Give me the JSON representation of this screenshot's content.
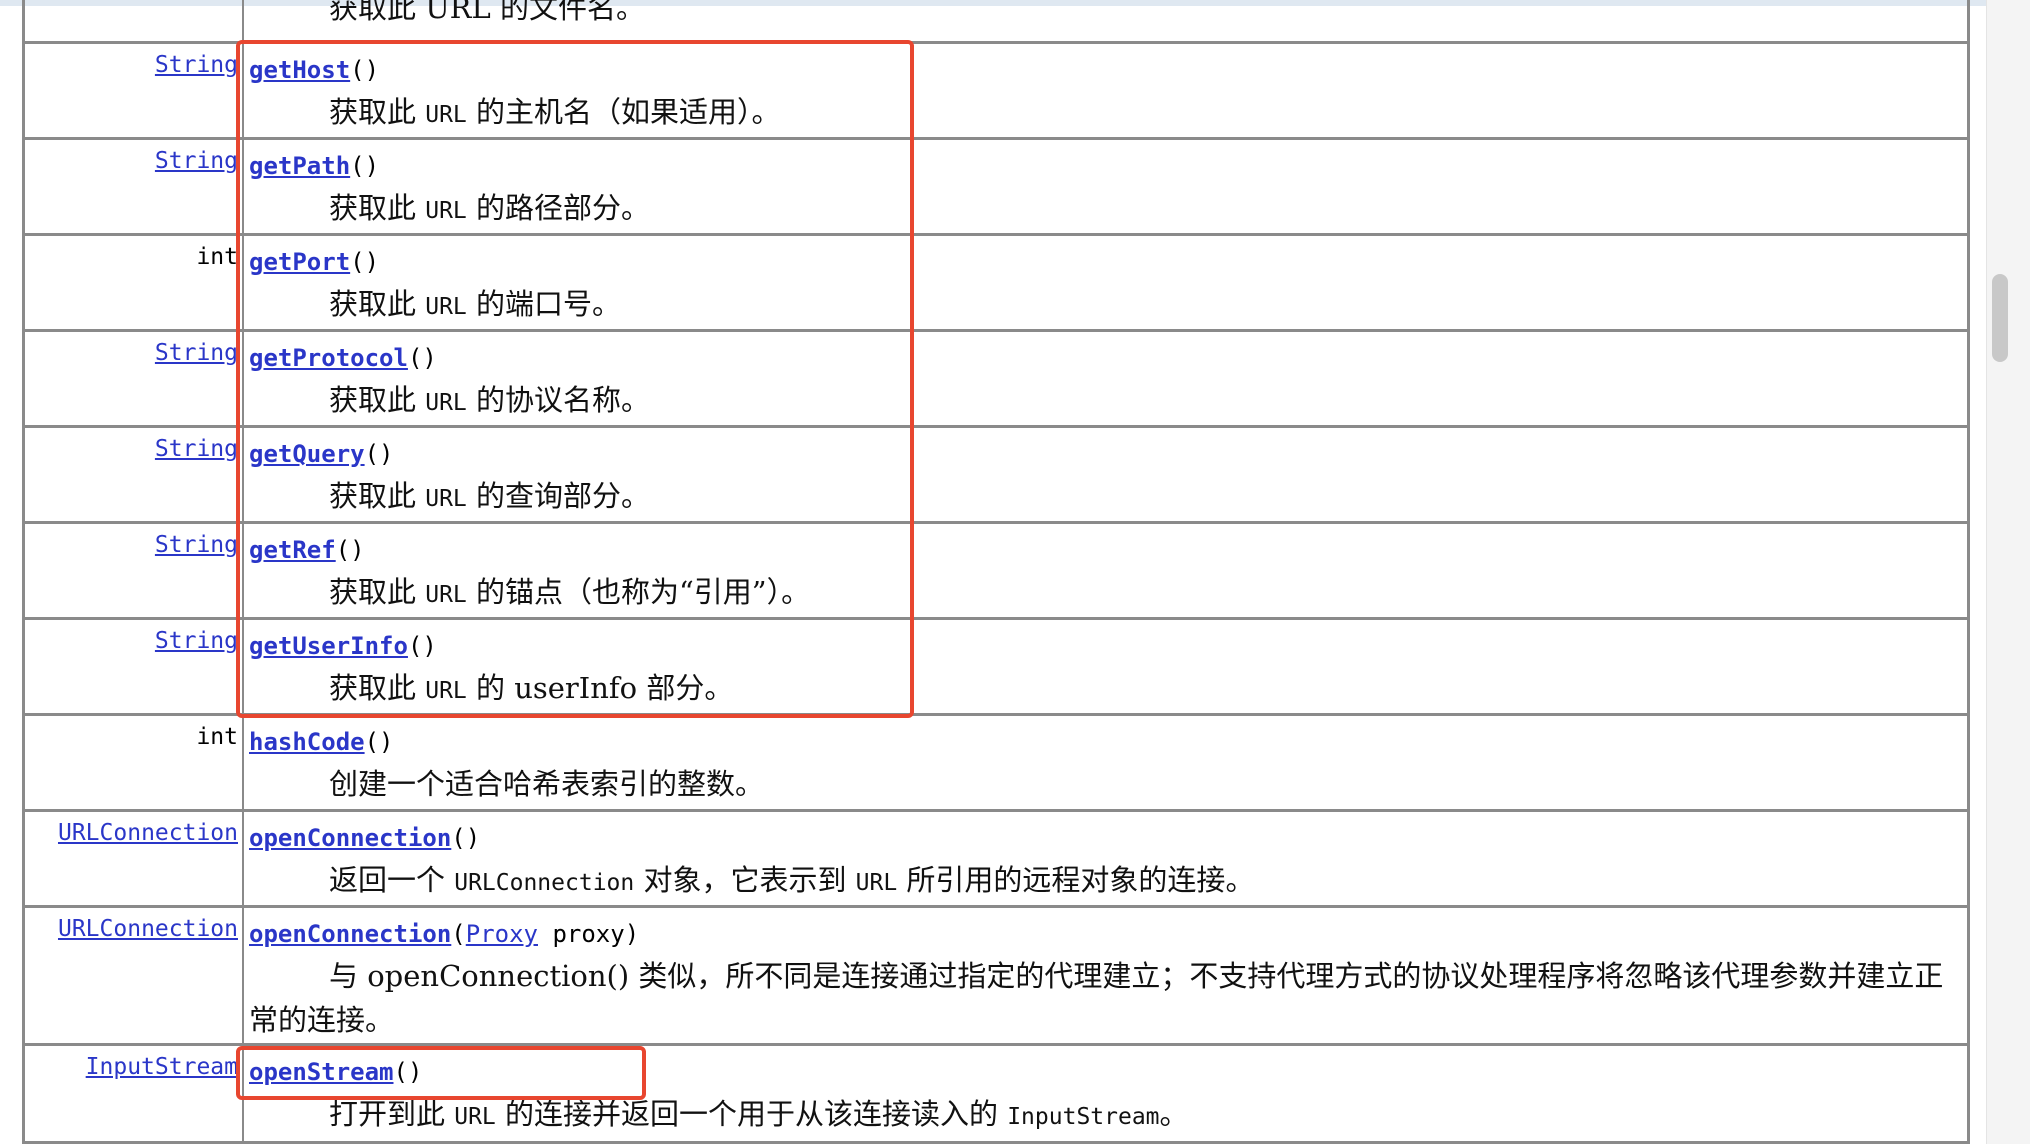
{
  "top_fragment": "获取此 URL 的文件名。",
  "rows": [
    {
      "type": "String",
      "type_link": true,
      "method": "getHost",
      "args": [],
      "desc": [
        "获取此 ",
        "URL",
        " 的主机名（如果适用）。"
      ]
    },
    {
      "type": "String",
      "type_link": true,
      "method": "getPath",
      "args": [],
      "desc": [
        "获取此 ",
        "URL",
        " 的路径部分。"
      ]
    },
    {
      "type": "int",
      "type_link": false,
      "method": "getPort",
      "args": [],
      "desc": [
        "获取此 ",
        "URL",
        " 的端口号。"
      ]
    },
    {
      "type": "String",
      "type_link": true,
      "method": "getProtocol",
      "args": [],
      "desc": [
        "获取此 ",
        "URL",
        " 的协议名称。"
      ]
    },
    {
      "type": "String",
      "type_link": true,
      "method": "getQuery",
      "args": [],
      "desc": [
        "获取此 ",
        "URL",
        " 的查询部分。"
      ]
    },
    {
      "type": "String",
      "type_link": true,
      "method": "getRef",
      "args": [],
      "desc": [
        "获取此 ",
        "URL",
        " 的锚点（也称为“引用”）。"
      ]
    },
    {
      "type": "String",
      "type_link": true,
      "method": "getUserInfo",
      "args": [],
      "desc": [
        "获取此 ",
        "URL",
        " 的 userInfo 部分。"
      ]
    },
    {
      "type": "int",
      "type_link": false,
      "method": "hashCode",
      "args": [],
      "desc": [
        "创建一个适合哈希表索引的整数。"
      ]
    },
    {
      "type": "URLConnection",
      "type_link": true,
      "method": "openConnection",
      "args": [],
      "desc": [
        "返回一个 ",
        "URLConnection",
        " 对象，它表示到 ",
        "URL",
        " 所引用的远程对象的连接。"
      ]
    },
    {
      "type": "URLConnection",
      "type_link": true,
      "method": "openConnection",
      "args": [
        "Proxy",
        " proxy"
      ],
      "desc": [
        "与 openConnection() 类似，所不同是连接通过指定的代理建立；不支持代理方式的协议处理程序将忽略该代理参数并建立正常的连接。"
      ]
    },
    {
      "type": "InputStream",
      "type_link": true,
      "method": "openStream",
      "args": [],
      "desc": [
        "打开到此 ",
        "URL",
        " 的连接并返回一个用于从该连接读入的 ",
        "InputStream",
        "。"
      ]
    }
  ],
  "paren_open": "(",
  "paren_close": ")",
  "highlight_color": "#e8462f",
  "link_color": "#2a36c8"
}
